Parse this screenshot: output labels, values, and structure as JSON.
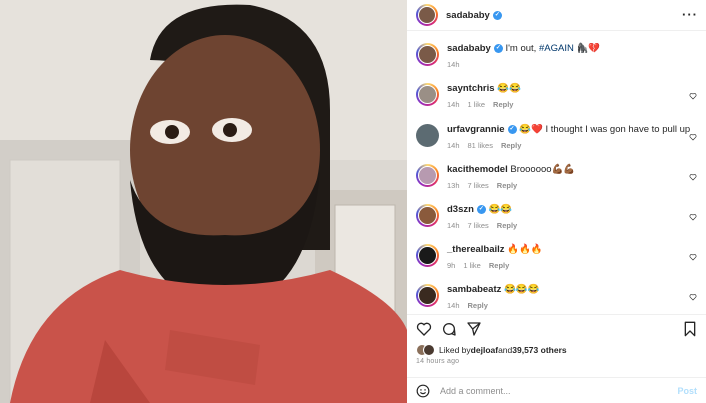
{
  "post": {
    "author": "sadababy",
    "caption_text": "I'm out, ",
    "caption_hashtag": "#AGAIN",
    "caption_emoji": " 🦍💔",
    "caption_time": "14h"
  },
  "comments": [
    {
      "user": "sayntchris",
      "verified": false,
      "text": "😂😂",
      "time": "14h",
      "likes": "1 like",
      "reply": "Reply",
      "avatar_color": "#9a8f86"
    },
    {
      "user": "urfavgrannie",
      "verified": true,
      "text": "😂❤️ I thought I was gon have to pull up",
      "time": "14h",
      "likes": "81 likes",
      "reply": "Reply",
      "avatar_color": "#5c6b72"
    },
    {
      "user": "kacithemodel",
      "verified": false,
      "text": "Broooooo💪🏾💪🏾",
      "time": "13h",
      "likes": "7 likes",
      "reply": "Reply",
      "avatar_color": "#b79ab0"
    },
    {
      "user": "d3szn",
      "verified": true,
      "text": "😂😂",
      "time": "14h",
      "likes": "7 likes",
      "reply": "Reply",
      "avatar_color": "#8a5a3c"
    },
    {
      "user": "_therealbailz",
      "verified": false,
      "text": "🔥🔥🔥",
      "time": "9h",
      "likes": "1 like",
      "reply": "Reply",
      "avatar_color": "#1a1a1a"
    },
    {
      "user": "sambabeatz",
      "verified": false,
      "text": "😂😂😂",
      "time": "14h",
      "likes": "",
      "reply": "Reply",
      "avatar_color": "#3a2a20"
    }
  ],
  "likes": {
    "prefix": "Liked by ",
    "first_user": "dejloaf",
    "middle": " and ",
    "others": "39,573 others"
  },
  "time_ago": "14 hours ago",
  "add_comment": {
    "placeholder": "Add a comment...",
    "post_label": "Post"
  },
  "colors": {
    "verified": "#3897f0",
    "hashtag": "#00376b",
    "secondary_text": "#8e8e8e",
    "post_disabled": "#b2dffc"
  },
  "icons": [
    "more-icon",
    "verified-icon",
    "heart-icon",
    "comment-icon",
    "share-icon",
    "bookmark-icon",
    "emoji-icon"
  ]
}
